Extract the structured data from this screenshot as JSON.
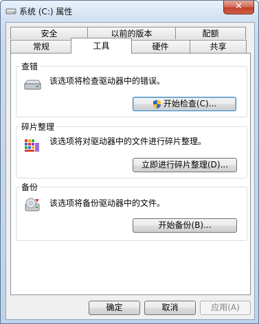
{
  "window": {
    "title": "系统 (C:) 属性",
    "close_label": "✕"
  },
  "tabs": {
    "row_back": [
      {
        "label": "安全"
      },
      {
        "label": "以前的版本"
      },
      {
        "label": "配额"
      }
    ],
    "row_front": [
      {
        "label": "常规"
      },
      {
        "label": "工具"
      },
      {
        "label": "硬件"
      },
      {
        "label": "共享"
      }
    ],
    "active": "工具"
  },
  "groups": {
    "error_check": {
      "title": "查错",
      "description": "该选项将检查驱动器中的错误。",
      "button_label": "开始检查(C)...",
      "icon": "drive-icon"
    },
    "defrag": {
      "title": "碎片整理",
      "description": "该选项将对驱动器中的文件进行碎片整理。",
      "button_label": "立即进行碎片整理(D)...",
      "icon": "defrag-icon"
    },
    "backup": {
      "title": "备份",
      "description": "该选项将备份驱动器中的文件。",
      "button_label": "开始备份(B)...",
      "icon": "backup-icon"
    }
  },
  "footer": {
    "ok_label": "确定",
    "cancel_label": "取消",
    "apply_label": "应用(A)"
  }
}
